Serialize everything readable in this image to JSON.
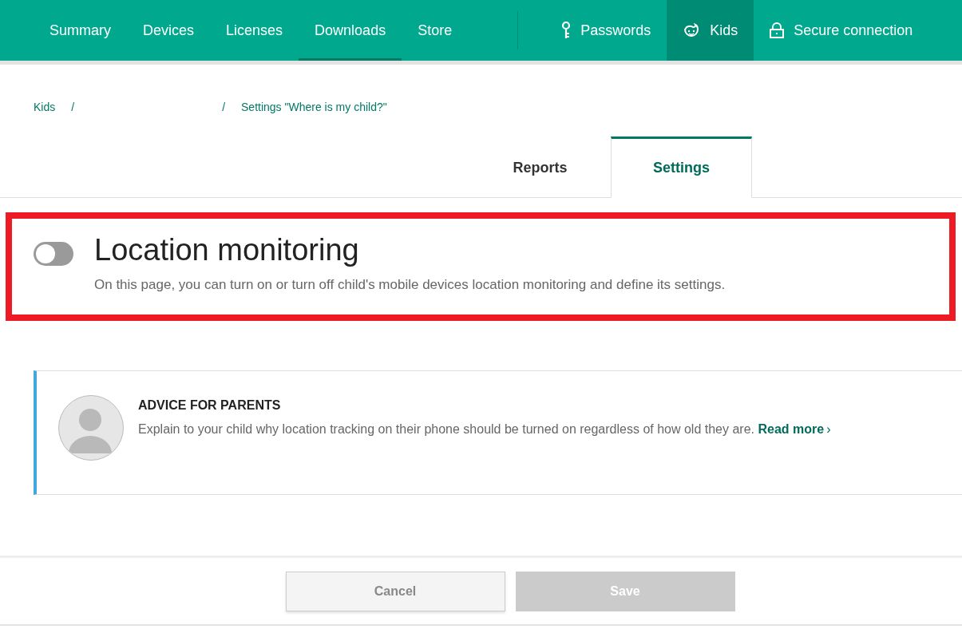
{
  "nav": {
    "main": [
      {
        "label": "Summary",
        "selected": false,
        "underlined": false
      },
      {
        "label": "Devices",
        "selected": false,
        "underlined": false
      },
      {
        "label": "Licenses",
        "selected": false,
        "underlined": false
      },
      {
        "label": "Downloads",
        "selected": false,
        "underlined": true
      },
      {
        "label": "Store",
        "selected": false,
        "underlined": false
      }
    ],
    "apps": [
      {
        "label": "Passwords",
        "kind": "key",
        "selected": false
      },
      {
        "label": "Kids",
        "kind": "kid",
        "selected": true
      },
      {
        "label": "Secure connection",
        "kind": "lock",
        "selected": false
      }
    ]
  },
  "breadcrumb": [
    {
      "kind": "link",
      "label": "Kids"
    },
    {
      "kind": "separator",
      "label": "/"
    },
    {
      "kind": "blank"
    },
    {
      "kind": "separator",
      "label": "/"
    },
    {
      "kind": "link",
      "label": "Settings \"Where is my child?\""
    }
  ],
  "tabs": [
    {
      "label": "Reports",
      "selected": false
    },
    {
      "label": "Settings",
      "selected": true
    }
  ],
  "section": {
    "on": false,
    "title": "Location monitoring",
    "description": "On this page, you can turn on or turn off child's mobile devices location monitoring and define its settings."
  },
  "advice": {
    "heading": "ADVICE FOR PARENTS",
    "text": "Explain to your child why location tracking on their phone should be turned on regardless of how old they are.",
    "link": "Read more",
    "link_arrow": "›"
  },
  "buttons": [
    {
      "label": "Cancel",
      "disabled": false
    },
    {
      "label": "Save",
      "disabled": true
    }
  ]
}
